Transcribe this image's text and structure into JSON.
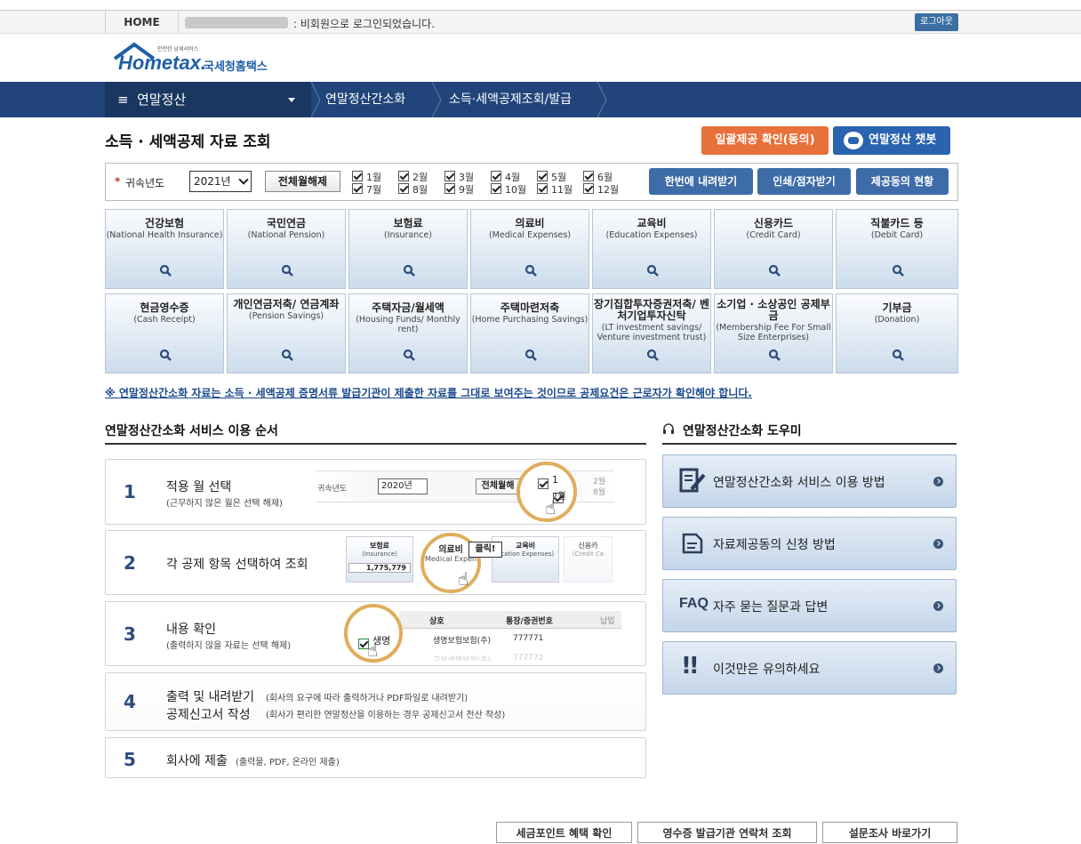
{
  "top": {
    "home": "HOME",
    "login_msg": ": 비회원으로 로그인되었습니다.",
    "logout": "로그아웃"
  },
  "logo": {
    "small": "안전한 납세서비스",
    "brand": "Hometax.",
    "brand_kr": "국세청홈택스"
  },
  "nav": {
    "menu": "연말정산",
    "crumb1": "연말정산간소화",
    "crumb2": "소득·세액공제조회/발급"
  },
  "page": {
    "title": "소득 · 세액공제 자료 조회",
    "consent_button": "일괄제공 확인(동의)",
    "chatbot_button": "연말정산 챗봇"
  },
  "filter": {
    "year_label": "귀속년도",
    "year_value": "2021년",
    "clear_all": "전체월해제",
    "months": [
      "1월",
      "2월",
      "3월",
      "4월",
      "5월",
      "6월",
      "7월",
      "8월",
      "9월",
      "10월",
      "11월",
      "12월"
    ],
    "download_btn": "한번에 내려받기",
    "print_btn": "인쇄/점자받기",
    "status_btn": "제공동의 현황"
  },
  "categories": [
    {
      "title": "건강보험",
      "sub": "(National Health Insurance)"
    },
    {
      "title": "국민연금",
      "sub": "(National Pension)"
    },
    {
      "title": "보험료",
      "sub": "(Insurance)"
    },
    {
      "title": "의료비",
      "sub": "(Medical Expenses)"
    },
    {
      "title": "교육비",
      "sub": "(Education Expenses)"
    },
    {
      "title": "신용카드",
      "sub": "(Credit Card)"
    },
    {
      "title": "직불카드 등",
      "sub": "(Debit Card)"
    },
    {
      "title": "현금영수증",
      "sub": "(Cash Receipt)"
    },
    {
      "title": "개인연금저축/ 연금계좌",
      "sub": "(Pension Savings)"
    },
    {
      "title": "주택자금/월세액",
      "sub": "(Housing Funds/ Monthly rent)"
    },
    {
      "title": "주택마련저축",
      "sub": "(Home Purchasing Savings)"
    },
    {
      "title": "장기집합투자증권저축/ 벤처기업투자신탁",
      "sub": "(LT investment savings/ Venture investment trust)"
    },
    {
      "title": "소기업 · 소상공인 공제부금",
      "sub": "(Membership Fee For Small Size Enterprises)"
    },
    {
      "title": "기부금",
      "sub": "(Donation)"
    }
  ],
  "notice": "※ 연말정산간소화 자료는 소득 · 세액공제 증명서류 발급기관이 제출한 자료를 그대로 보여주는 것이므로 공제요건은 근로자가 확인해야 합니다.",
  "steps_title": "연말정산간소화 서비스 이용 순서",
  "steps": [
    {
      "num": "1",
      "title": "적용 월 선택",
      "sub": "(근무하지 않은 월은 선택 해제)"
    },
    {
      "num": "2",
      "title": "각 공제 항목 선택하여 조회",
      "sub": ""
    },
    {
      "num": "3",
      "title": "내용 확인",
      "sub": "(출력하지 않을 자료는 선택 해제)"
    },
    {
      "num": "4",
      "title": "출력 및 내려받기",
      "sub": "(회사의 요구에 따라 출력하거나 PDF파일로 내려받기)",
      "title2": "공제신고서 작성",
      "sub2": "(회사가 편리한 연말정산을 이용하는 경우 공제신고서 전산 작성)"
    },
    {
      "num": "5",
      "title": "회사에 제출",
      "sub": "(출력물, PDF, 온라인 제출)"
    }
  ],
  "step_images": {
    "s1_year_label": "귀속년도",
    "s1_year": "2020년",
    "s1_clear": "전체월해",
    "s1_m1": "1",
    "s1_m2": "2월",
    "s1_m7": "7월",
    "s1_m8": "8월",
    "s2_card1": "보험료",
    "s2_card1_sub": "(Insurance)",
    "s2_amount": "1,775,779",
    "s2_card2": "의료비",
    "s2_card2_sub": "Medical Expen",
    "s2_click": "클릭!",
    "s2_card3": "교육비",
    "s2_card3_sub": "ucation Expenses)",
    "s2_card4": "신용카",
    "s2_card4_sub": "(Credit Ca",
    "s3_col1": "상호",
    "s3_col2": "통장/증권번호",
    "s3_col3": "납입",
    "s3_row1": "생명보험보험(주)",
    "s3_row1_no": "777771",
    "s3_row1_prefix": "생명",
    "s3_row2": "교보생명보험(주)",
    "s3_row2_no": "777772"
  },
  "helper_title": "연말정산간소화 도우미",
  "helpers": [
    {
      "label": "연말정산간소화 서비스 이용 방법",
      "icon": "document-edit-icon"
    },
    {
      "label": "자료제공동의 신청 방법",
      "icon": "document-icon"
    },
    {
      "label": "자주 묻는 질문과 답변",
      "icon": "faq-icon",
      "icon_text": "FAQ"
    },
    {
      "label": "이것만은 유의하세요",
      "icon": "exclamation-icon"
    }
  ],
  "bottom": [
    "세금포인트 혜택 확인",
    "영수증 발급기관 연락처 조회",
    "설문조사 바로가기"
  ],
  "colors": {
    "nav": "#21457a",
    "consent": "#e8703a",
    "chatbot": "#2a63b0",
    "button": "#3d6ca8",
    "notice": "#1c4a8c",
    "highlight_ring": "#e0ad5c"
  }
}
